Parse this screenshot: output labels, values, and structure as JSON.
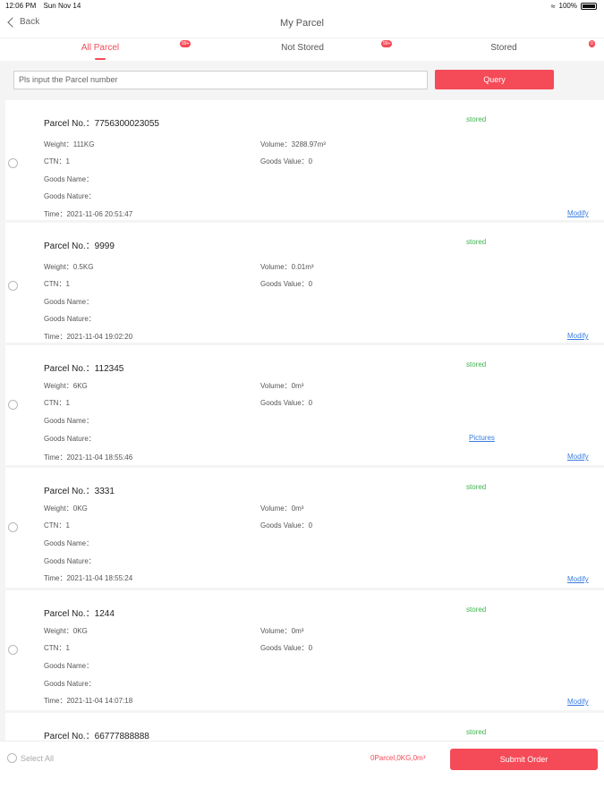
{
  "status_bar": {
    "time": "12:06 PM",
    "date": "Sun Nov 14",
    "battery": "100%"
  },
  "nav": {
    "back_label": "Back",
    "title": "My Parcel"
  },
  "tabs": [
    {
      "label": "All Parcel",
      "badge": "99+",
      "active": true
    },
    {
      "label": "Not Stored",
      "badge": "99+",
      "active": false
    },
    {
      "label": "Stored",
      "badge": "0",
      "active": false
    }
  ],
  "search": {
    "placeholder": "Pls input the Parcel number",
    "query_label": "Query"
  },
  "parcels": [
    {
      "parcel_label": "Parcel No.：7756300023055",
      "status": "stored",
      "weight": "Weight：111KG",
      "volume": "Volume：3288.97m³",
      "ctn": "CTN：1",
      "goods_value": "Goods Value：0",
      "goods_name": "Goods Name：",
      "goods_nature": "Goods Nature：",
      "time": "Time：2021-11-06 20:51:47",
      "pictures": "",
      "action": "Modify"
    },
    {
      "parcel_label": "Parcel No.：9999",
      "status": "stored",
      "weight": "Weight：0.5KG",
      "volume": "Volume：0.01m³",
      "ctn": "CTN：1",
      "goods_value": "Goods Value：0",
      "goods_name": "Goods Name：",
      "goods_nature": "Goods Nature：",
      "time": "Time：2021-11-04 19:02:20",
      "pictures": "",
      "action": "Modify"
    },
    {
      "parcel_label": "Parcel No.：112345",
      "status": "stored",
      "weight": "Weight：6KG",
      "volume": "Volume：0m³",
      "ctn": "CTN：1",
      "goods_value": "Goods Value：0",
      "goods_name": "Goods Name：",
      "goods_nature": "Goods Nature：",
      "time": "Time：2021-11-04 18:55:46",
      "pictures": "Pictures",
      "action": "Modify"
    },
    {
      "parcel_label": "Parcel No.：3331",
      "status": "stored",
      "weight": "Weight：0KG",
      "volume": "Volume：0m³",
      "ctn": "CTN：1",
      "goods_value": "Goods Value：0",
      "goods_name": "Goods Name：",
      "goods_nature": "Goods Nature：",
      "time": "Time：2021-11-04 18:55:24",
      "pictures": "",
      "action": "Modify"
    },
    {
      "parcel_label": "Parcel No.：1244",
      "status": "stored",
      "weight": "Weight：0KG",
      "volume": "Volume：0m³",
      "ctn": "CTN：1",
      "goods_value": "Goods Value：0",
      "goods_name": "Goods Name：",
      "goods_nature": "Goods Nature：",
      "time": "Time：2021-11-04 14:07:18",
      "pictures": "",
      "action": "Modify"
    },
    {
      "parcel_label": "Parcel No.：66777888888",
      "status": "stored",
      "weight": "",
      "volume": "",
      "ctn": "",
      "goods_value": "",
      "goods_name": "",
      "goods_nature": "",
      "time": "",
      "pictures": "",
      "action": ""
    }
  ],
  "bottom": {
    "select_all": "Select All",
    "totals": "0Parcel,0KG,0m³",
    "submit_label": "Submit Order"
  },
  "colors": {
    "accent": "#f54a57",
    "status_green": "#3fb34f",
    "link_blue": "#3a7de0",
    "background": "#f4f4f4"
  },
  "icons": {
    "back": "chevron-left-icon",
    "wifi": "wifi-icon",
    "battery": "battery-icon",
    "radio": "radio-circle-icon"
  }
}
